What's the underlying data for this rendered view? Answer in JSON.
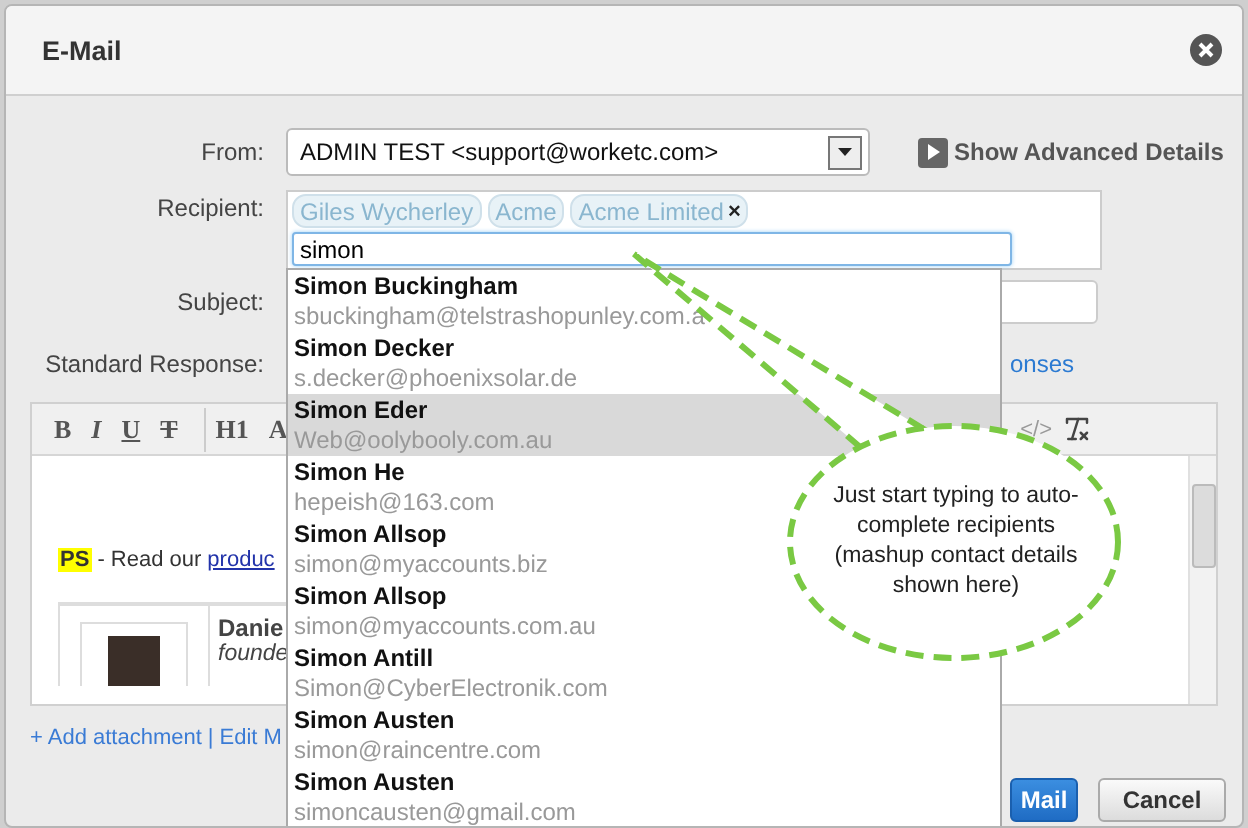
{
  "dialog": {
    "title": "E-Mail"
  },
  "form": {
    "from": {
      "label": "From:",
      "value": "ADMIN TEST <support@worketc.com>"
    },
    "advanced_link": "Show Advanced Details",
    "recipient": {
      "label": "Recipient:",
      "query": "simon",
      "tokens": [
        {
          "text": "Giles Wycherley"
        },
        {
          "text": "Acme"
        },
        {
          "text": "Acme Limited",
          "remove": "×"
        }
      ]
    },
    "subject": {
      "label": "Subject:"
    },
    "standard_response": {
      "label": "Standard Response:",
      "link": "onses"
    }
  },
  "editor": {
    "toolbar": [
      {
        "label": "B",
        "kind": "bold"
      },
      {
        "label": "I",
        "kind": "italic"
      },
      {
        "label": "U",
        "kind": "underline"
      },
      {
        "label": "T",
        "kind": "strike"
      },
      {
        "label": "H1",
        "kind": "heading"
      },
      {
        "label": "A",
        "kind": "color"
      },
      {
        "label": "</>",
        "kind": "source"
      }
    ],
    "ps_badge": "PS",
    "ps_text": "- Read our",
    "ps_link": "produc",
    "signature": {
      "name": "Danie",
      "title": "founde"
    }
  },
  "footer": {
    "add_attachment": "+ Add attachment",
    "separator": "|",
    "edit_link": "Edit M"
  },
  "buttons": [
    {
      "label": "Mail",
      "kind": "primary"
    },
    {
      "label": "Cancel",
      "kind": "secondary"
    }
  ],
  "autocomplete": {
    "items": [
      {
        "name": "Simon Buckingham",
        "email": "sbuckingham@telstrashopunley.com.a",
        "selected": false
      },
      {
        "name": "Simon Decker",
        "email": "s.decker@phoenixsolar.de",
        "selected": false
      },
      {
        "name": "Simon Eder",
        "email": "Web@oolybooly.com.au",
        "selected": true
      },
      {
        "name": "Simon He",
        "email": "hepeish@163.com",
        "selected": false
      },
      {
        "name": "Simon Allsop",
        "email": "simon@myaccounts.biz",
        "selected": false
      },
      {
        "name": "Simon Allsop",
        "email": "simon@myaccounts.com.au",
        "selected": false
      },
      {
        "name": "Simon Antill",
        "email": "Simon@CyberElectronik.com",
        "selected": false
      },
      {
        "name": "Simon Austen",
        "email": "simon@raincentre.com",
        "selected": false
      },
      {
        "name": "Simon Austen",
        "email": "simoncausten@gmail.com",
        "selected": false
      }
    ]
  },
  "callout": {
    "text": "Just start typing to auto-complete recipients (mashup contact details shown here)"
  }
}
